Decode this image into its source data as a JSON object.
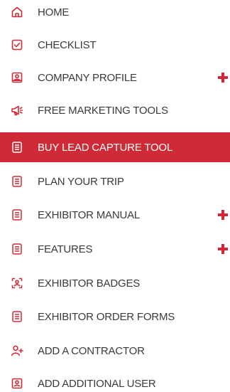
{
  "menu": {
    "items": [
      {
        "label": "HOME",
        "icon": "home-icon"
      },
      {
        "label": "CHECKLIST",
        "icon": "checklist-icon"
      },
      {
        "label": "COMPANY PROFILE",
        "icon": "company-profile-icon",
        "expandable": true
      },
      {
        "label": "FREE MARKETING TOOLS",
        "icon": "megaphone-icon"
      },
      {
        "label": "BUY LEAD CAPTURE TOOL",
        "icon": "document-list-icon",
        "active": true
      },
      {
        "label": "PLAN YOUR TRIP",
        "icon": "document-list-icon"
      },
      {
        "label": "EXHIBITOR MANUAL",
        "icon": "document-list-icon",
        "expandable": true
      },
      {
        "label": "FEATURES",
        "icon": "document-list-icon",
        "expandable": true
      },
      {
        "label": "EXHIBITOR BADGES",
        "icon": "badge-scan-icon"
      },
      {
        "label": "EXHIBITOR ORDER FORMS",
        "icon": "document-list-icon"
      },
      {
        "label": "ADD A CONTRACTOR",
        "icon": "add-person-icon"
      },
      {
        "label": "ADD ADDITIONAL USER",
        "icon": "user-card-icon"
      }
    ]
  },
  "colors": {
    "accent": "#cf2a36",
    "text": "#3a3a3a",
    "active_text": "#ffffff"
  }
}
